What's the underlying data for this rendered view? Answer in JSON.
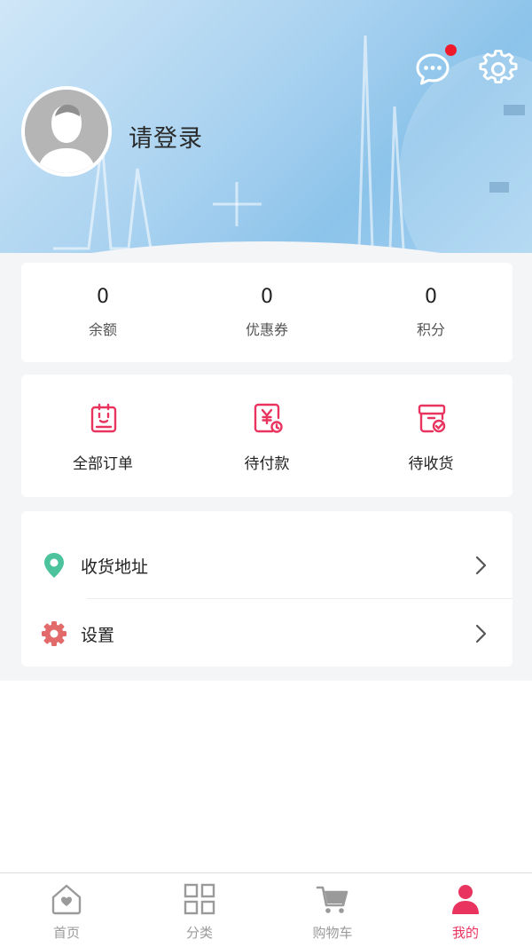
{
  "header": {
    "login_text": "请登录",
    "has_unread_messages": true
  },
  "stats": [
    {
      "value": "0",
      "label": "余额"
    },
    {
      "value": "0",
      "label": "优惠券"
    },
    {
      "value": "0",
      "label": "积分"
    }
  ],
  "orders": [
    {
      "label": "全部订单",
      "icon": "clipboard-icon"
    },
    {
      "label": "待付款",
      "icon": "yen-bill-icon"
    },
    {
      "label": "待收货",
      "icon": "delivery-box-icon"
    }
  ],
  "menu": [
    {
      "label": "收货地址",
      "icon": "location-pin-icon"
    },
    {
      "label": "设置",
      "icon": "gear-icon"
    }
  ],
  "tabs": [
    {
      "label": "首页",
      "icon": "home-heart-icon",
      "active": false
    },
    {
      "label": "分类",
      "icon": "grid-icon",
      "active": false
    },
    {
      "label": "购物车",
      "icon": "cart-icon",
      "active": false
    },
    {
      "label": "我的",
      "icon": "person-icon",
      "active": true
    }
  ],
  "colors": {
    "accent": "#e8345f",
    "badge": "#ee1a2c",
    "location_green": "#4cc39c",
    "settings_red": "#e26a6a",
    "tab_inactive": "#9a9a9a"
  }
}
